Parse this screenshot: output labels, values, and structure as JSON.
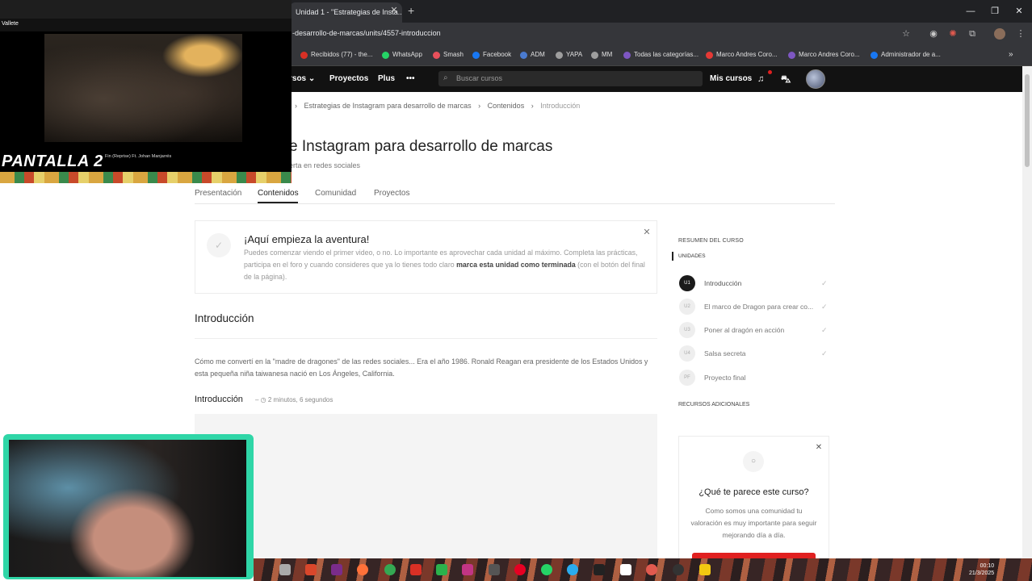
{
  "browser": {
    "tab_title": "Unidad 1 - \"Estrategias de Insta...",
    "tab_close": "✕",
    "new_tab": "+",
    "url": "-desarrollo-de-marcas/units/4557-introduccion",
    "window_controls": {
      "minimize": "—",
      "restore": "❐",
      "close": "✕"
    },
    "bookmarks": [
      {
        "label": "Recibidos (77) - the...",
        "color": "#d93025"
      },
      {
        "label": "WhatsApp",
        "color": "#25d366"
      },
      {
        "label": "Smash",
        "color": "#e8505b"
      },
      {
        "label": "Facebook",
        "color": "#1877f2"
      },
      {
        "label": "ADM",
        "color": "#4a7bd0"
      },
      {
        "label": "YAPA",
        "color": "#9e9e9e"
      },
      {
        "label": "MM",
        "color": "#9e9e9e"
      },
      {
        "label": "Todas las categorías...",
        "color": "#7e57c2"
      },
      {
        "label": "Marco Andres Coro...",
        "color": "#e53935"
      },
      {
        "label": "Marco Andres Coro...",
        "color": "#7e57c2"
      },
      {
        "label": "Administrador de a...",
        "color": "#1877f2"
      }
    ],
    "bookmarks_more": "»"
  },
  "site_nav": {
    "cursos": "rsos ⌄",
    "proyectos": "Proyectos",
    "plus": "Plus",
    "more": "•••",
    "search_placeholder": "Buscar cursos",
    "mis_cursos": "Mis cursos",
    "bell_icon": "🔔",
    "cart_icon": "🛒"
  },
  "breadcrumb": {
    "sep": "›",
    "course": "Estrategias de Instagram para desarrollo de marcas",
    "contents": "Contenidos",
    "current": "Introducción"
  },
  "course": {
    "title": "e Instagram para desarrollo de marcas",
    "subtitle": "erta en redes sociales"
  },
  "tabs": [
    "Presentación",
    "Contenidos",
    "Comunidad",
    "Proyectos"
  ],
  "notice": {
    "check": "✓",
    "close": "✕",
    "title": "¡Aquí empieza la aventura!",
    "body_1": "Puedes comenzar viendo el primer video, o no. Lo importante es aprovechar cada unidad al máximo. Completa las prácticas, participa en el foro y cuando consideres que ya lo tienes todo claro ",
    "body_bold": "marca esta unidad como terminada",
    "body_2": " (con el botón del final de la página)."
  },
  "lesson": {
    "heading": "Introducción",
    "text": "Cómo me convertí en la \"madre de dragones\" de las redes sociales... Era el año 1986. Ronald Reagan era presidente de los Estados Unidos y esta pequeña niña taiwanesa nació en Los Ángeles, California.",
    "video_title": "Introducción",
    "video_meta": "–  ◷ 2 minutos, 6 segundos"
  },
  "sidebar": {
    "summary_label": "RESUMEN DEL CURSO",
    "units_label": "UNIDADES",
    "units": [
      {
        "badge": "U1",
        "label": "Introducción",
        "check": "✓"
      },
      {
        "badge": "U2",
        "label": "El marco de Dragon para crear co...",
        "check": "✓"
      },
      {
        "badge": "U3",
        "label": "Poner al dragón en acción",
        "check": "✓"
      },
      {
        "badge": "U4",
        "label": "Salsa secreta",
        "check": "✓"
      },
      {
        "badge": "PF",
        "label": "Proyecto final",
        "check": ""
      }
    ],
    "resources_label": "RECURSOS ADICIONALES",
    "feedback": {
      "close": "✕",
      "icon": "💬",
      "title": "¿Qué te parece este curso?",
      "body": "Como somos una comunidad tu valoración es muy importante para seguir mejorando día a día."
    }
  },
  "overlay": {
    "caption": "PANTALLA 2",
    "song": "Fin (Reprise) Ft. Johan Manjarrés",
    "logo": "Vallete"
  },
  "taskbar": {
    "clock_time": "00:10",
    "clock_date": "21/3/2025"
  }
}
